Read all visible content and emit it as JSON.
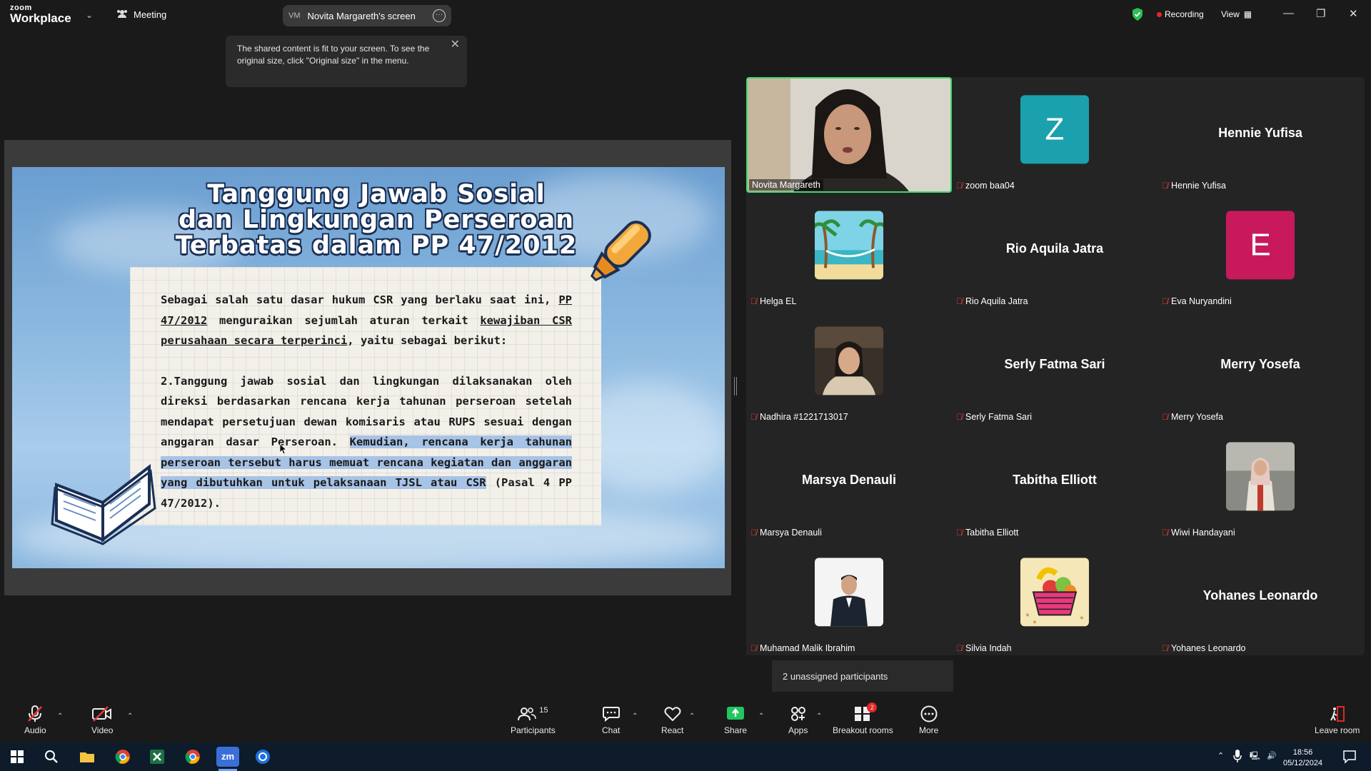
{
  "app": {
    "brand_small": "zoom",
    "brand_name": "Workplace",
    "meeting_label": "Meeting"
  },
  "share_pill": {
    "initials": "VM",
    "label": "Novita Margareth's screen"
  },
  "top_right": {
    "recording": "Recording",
    "view": "View"
  },
  "tooltip": {
    "text": "The shared content is fit to your screen. To see the original size, click \"Original size\" in the menu."
  },
  "slide": {
    "title_line1": "Tanggung Jawab Sosial",
    "title_line2": "dan Lingkungan Perseroan",
    "title_line3": "Terbatas dalam PP 47/2012",
    "para1_a": "Sebagai salah satu dasar hukum CSR yang berlaku saat ini, ",
    "para1_link": "PP 47/2012",
    "para1_b": " menguraikan sejumlah aturan terkait ",
    "para1_link2": "kewajiban CSR perusahaan secara terperinci",
    "para1_c": ", yaitu sebagai berikut:",
    "para2_a": "2.Tanggung jawab sosial dan lingkungan dilaksanakan oleh direksi berdasarkan rencana kerja tahunan perseroan setelah mendapat persetujuan dewan komisaris atau RUPS sesuai dengan anggaran dasar Perseroan. ",
    "para2_hl": "Kemudian, rencana kerja tahunan perseroan tersebut harus memuat rencana kegiatan dan anggaran yang dibutuhkan untuk pelaksanaan TJSL atau CSR",
    "para2_b": " (Pasal 4 PP 47/2012)."
  },
  "participants": [
    {
      "name": "Novita Margareth",
      "type": "video"
    },
    {
      "name": "zoom baa04",
      "type": "initial",
      "initial": "Z",
      "color": "#1aa1ad"
    },
    {
      "name": "Hennie Yufisa",
      "type": "name",
      "display": "Hennie Yufisa"
    },
    {
      "name": "Helga EL",
      "type": "photo"
    },
    {
      "name": "Rio Aquila Jatra",
      "type": "name",
      "display": "Rio Aquila Jatra"
    },
    {
      "name": "Eva Nuryandini",
      "type": "initial",
      "initial": "E",
      "color": "#c8195c"
    },
    {
      "name": "Nadhira #1221713017",
      "type": "photo"
    },
    {
      "name": "Serly Fatma Sari",
      "type": "name",
      "display": "Serly Fatma Sari"
    },
    {
      "name": "Merry Yosefa",
      "type": "name",
      "display": "Merry Yosefa"
    },
    {
      "name": "Marsya Denauli",
      "type": "name",
      "display": "Marsya Denauli"
    },
    {
      "name": "Tabitha Elliott",
      "type": "name",
      "display": "Tabitha Elliott"
    },
    {
      "name": "Wiwi Handayani",
      "type": "photo"
    },
    {
      "name": "Muhamad Malik Ibrahim",
      "type": "photo"
    },
    {
      "name": "Silvia Indah",
      "type": "photo"
    },
    {
      "name": "Yohanes Leonardo",
      "type": "name",
      "display": "Yohanes Leonardo"
    }
  ],
  "unassigned": "2 unassigned participants",
  "toolbar": {
    "audio": "Audio",
    "video": "Video",
    "participants": "Participants",
    "participants_count": "15",
    "chat": "Chat",
    "react": "React",
    "share": "Share",
    "apps": "Apps",
    "breakout": "Breakout rooms",
    "breakout_badge": "2",
    "more": "More",
    "leave": "Leave room"
  },
  "taskbar": {
    "time": "18:56",
    "date": "05/12/2024"
  },
  "colors": {
    "accent_green": "#3ed96b",
    "share_green": "#22c55e",
    "record_red": "#e02828",
    "mute_red": "#e03a3a"
  }
}
